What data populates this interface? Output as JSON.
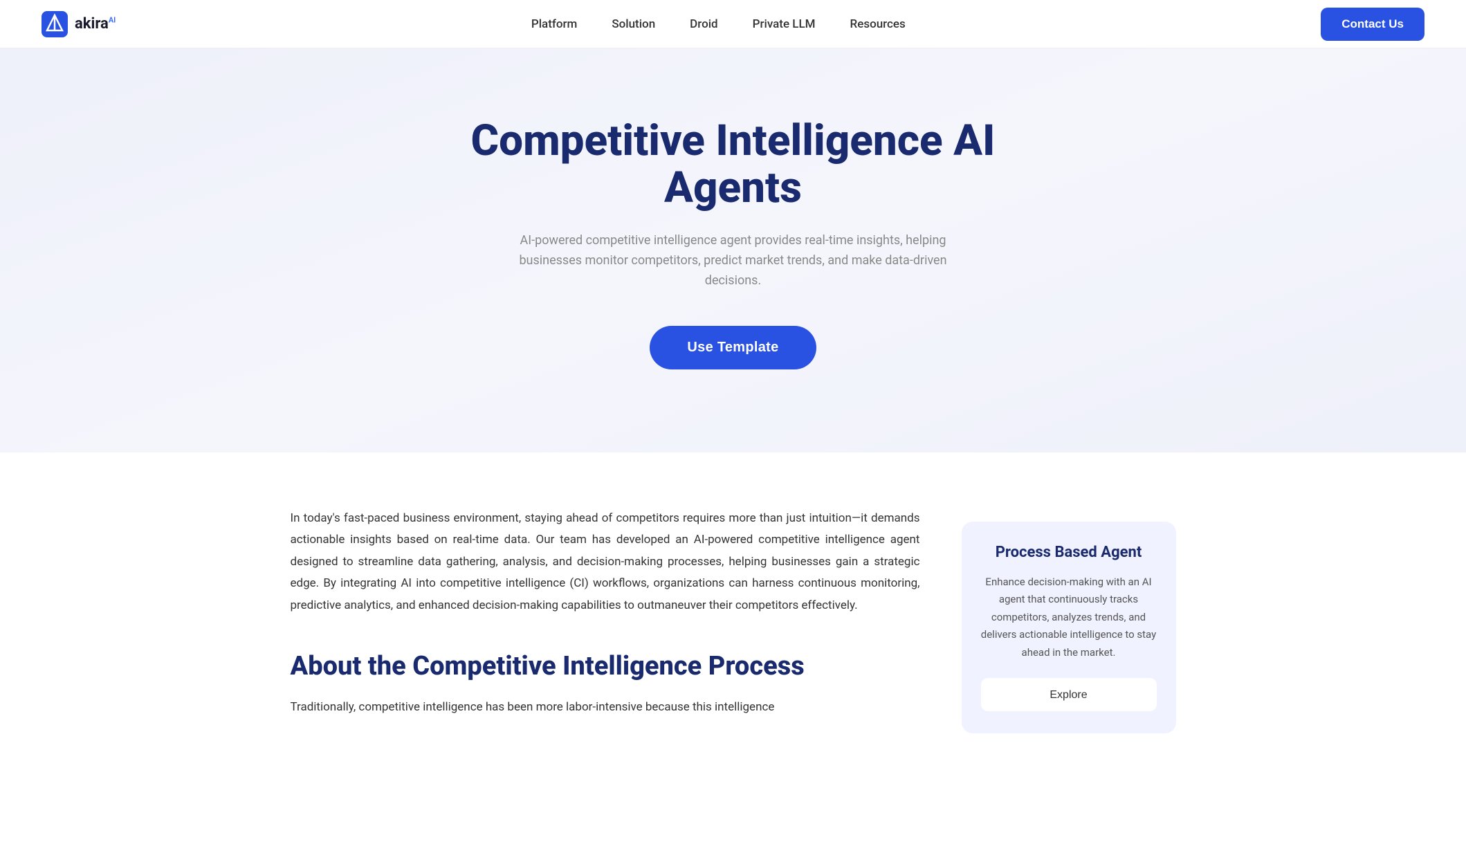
{
  "navbar": {
    "logo_text": "akira",
    "logo_sup": "AI",
    "nav_items": [
      {
        "label": "Platform",
        "href": "#"
      },
      {
        "label": "Solution",
        "href": "#"
      },
      {
        "label": "Droid",
        "href": "#"
      },
      {
        "label": "Private LLM",
        "href": "#"
      },
      {
        "label": "Resources",
        "href": "#"
      }
    ],
    "contact_label": "Contact Us"
  },
  "hero": {
    "title": "Competitive Intelligence AI Agents",
    "subtitle": "AI-powered competitive intelligence agent provides real-time insights, helping businesses monitor competitors, predict market trends, and make data-driven decisions.",
    "cta_label": "Use Template"
  },
  "intro": {
    "paragraph": "In today's fast-paced business environment, staying ahead of competitors requires more than just intuition—it demands actionable insights based on real-time data. Our team has developed an AI-powered competitive intelligence agent designed to streamline data gathering, analysis, and decision-making processes, helping businesses gain a strategic edge. By integrating AI into competitive intelligence (CI) workflows, organizations can harness continuous monitoring, predictive analytics, and enhanced decision-making capabilities to outmaneuver their competitors effectively."
  },
  "about_section": {
    "heading": "About the Competitive Intelligence Process",
    "text": "Traditionally, competitive intelligence has been more labor-intensive because this intelligence"
  },
  "sidebar_card": {
    "title": "Process Based Agent",
    "body": "Enhance decision-making with an AI agent that continuously tracks competitors, analyzes trends, and delivers actionable intelligence to stay ahead in the market.",
    "explore_label": "Explore"
  }
}
